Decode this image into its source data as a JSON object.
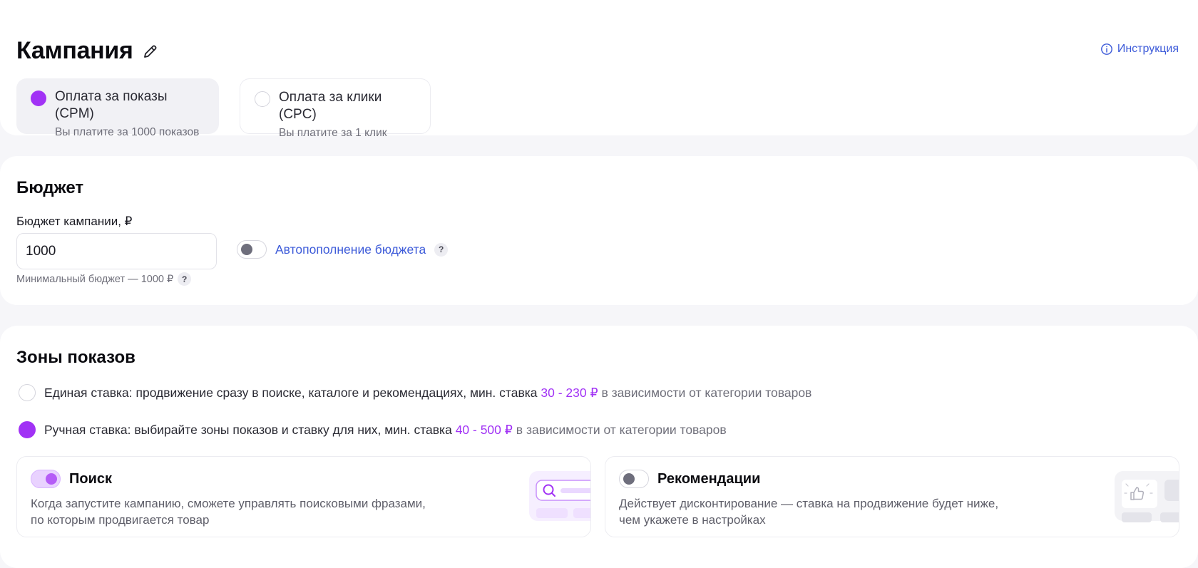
{
  "campaign": {
    "title": "Кампания",
    "help_link": "Инструкция",
    "pay_options": [
      {
        "title": "Оплата за показы (CPM)",
        "subtitle": "Вы платите за 1000 показов",
        "selected": true
      },
      {
        "title": "Оплата за клики (CPC)",
        "subtitle": "Вы платите за 1 клик",
        "selected": false
      }
    ]
  },
  "budget": {
    "title": "Бюджет",
    "field_label": "Бюджет кампании, ₽",
    "value": "1000",
    "hint": "Минимальный бюджет — 1000 ₽",
    "autofill_label": "Автопополнение бюджета",
    "autofill_enabled": false,
    "help_symbol": "?"
  },
  "zones": {
    "title": "Зоны показов",
    "single": {
      "text": "Единая ставка: продвижение сразу в поиске, каталоге и рекомендациях, мин. ставка",
      "range": "30 - 230 ₽",
      "suffix": "в зависимости от категории товаров",
      "selected": false
    },
    "manual": {
      "text": "Ручная ставка: выбирайте зоны показов и ставку для них, мин. ставка",
      "range": "40 - 500 ₽",
      "suffix": "в зависимости от категории товаров",
      "selected": true
    },
    "cards": [
      {
        "title": "Поиск",
        "enabled": true,
        "line1": "Когда запустите кампанию, сможете управлять поисковыми фразами,",
        "line2": "по которым продвигается товар"
      },
      {
        "title": "Рекомендации",
        "enabled": false,
        "line1": "Действует дисконтирование — ставка на продвижение будет ниже,",
        "line2": "чем укажете в настройках"
      }
    ]
  },
  "colors": {
    "accent": "#a132f5",
    "link": "#3d5bd9",
    "background": "#f6f6f9"
  },
  "icons": [
    "pencil-icon",
    "info-icon",
    "search-icon",
    "thumbs-up-icon"
  ]
}
